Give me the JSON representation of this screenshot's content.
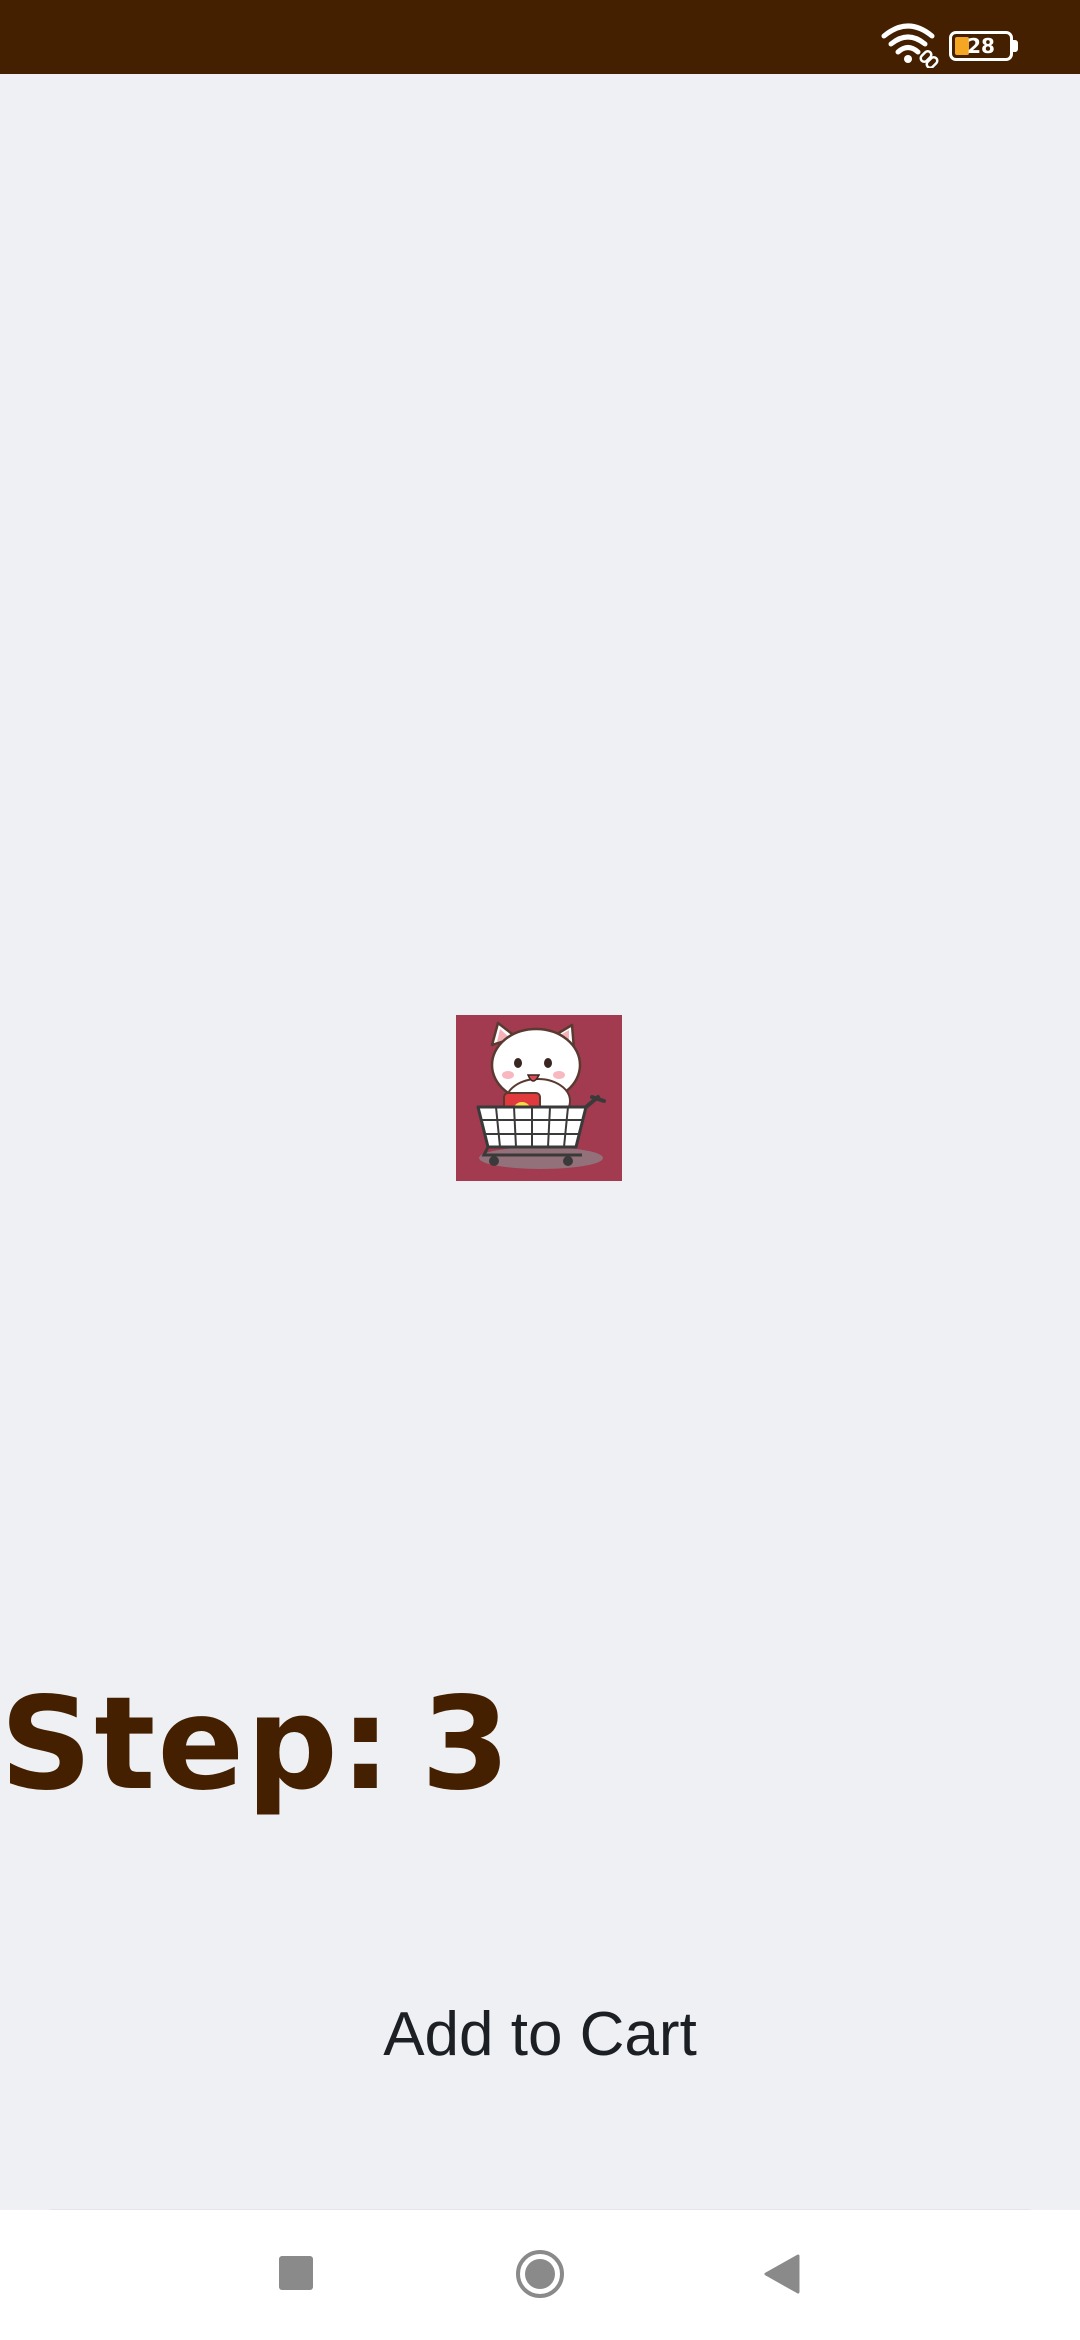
{
  "status_bar": {
    "battery_level": "28",
    "icons": [
      "wifi-icon",
      "link-icon",
      "battery-icon"
    ],
    "background_color": "#442000"
  },
  "product": {
    "image_icon": "cat-in-shopping-cart-image",
    "image_background_color": "#a23a50"
  },
  "step": {
    "label": "Step:",
    "value": "3",
    "color": "#442000"
  },
  "actions": {
    "add_to_cart_label": "Add to Cart"
  },
  "navigation_bar": {
    "icons": [
      "recents-square-icon",
      "home-circle-icon",
      "back-triangle-icon"
    ]
  }
}
